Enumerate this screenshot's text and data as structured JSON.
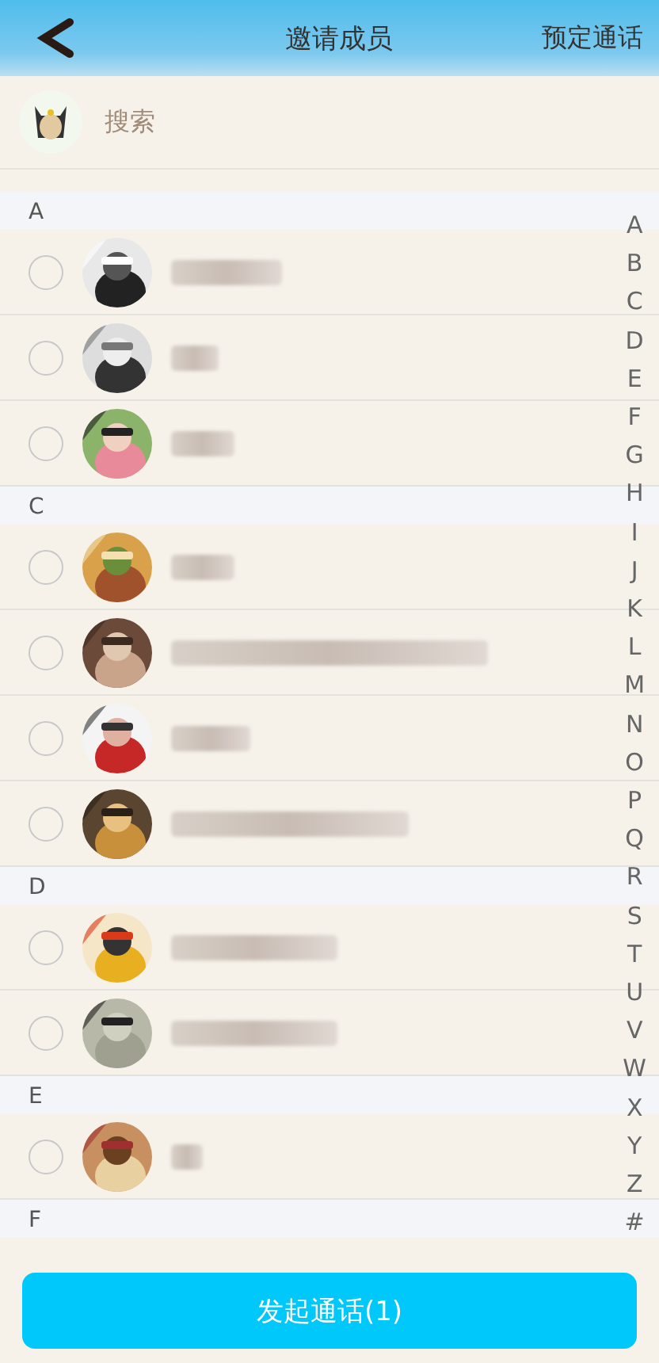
{
  "header": {
    "title": "邀请成员",
    "action": "预定通话"
  },
  "search": {
    "placeholder": "搜索"
  },
  "sections": [
    {
      "letter": "A",
      "contacts": [
        {
          "checked": false
        },
        {
          "checked": false
        },
        {
          "checked": false
        }
      ]
    },
    {
      "letter": "C",
      "contacts": [
        {
          "checked": false
        },
        {
          "checked": false
        },
        {
          "checked": false
        },
        {
          "checked": false
        }
      ]
    },
    {
      "letter": "D",
      "contacts": [
        {
          "checked": false
        },
        {
          "checked": false
        }
      ]
    },
    {
      "letter": "E",
      "contacts": [
        {
          "checked": false
        }
      ]
    },
    {
      "letter": "F"
    }
  ],
  "index": [
    "A",
    "B",
    "C",
    "D",
    "E",
    "F",
    "G",
    "H",
    "I",
    "J",
    "K",
    "L",
    "M",
    "N",
    "O",
    "P",
    "Q",
    "R",
    "S",
    "T",
    "U",
    "V",
    "W",
    "X",
    "Y",
    "Z",
    "#"
  ],
  "start_button": "发起通话(1)"
}
